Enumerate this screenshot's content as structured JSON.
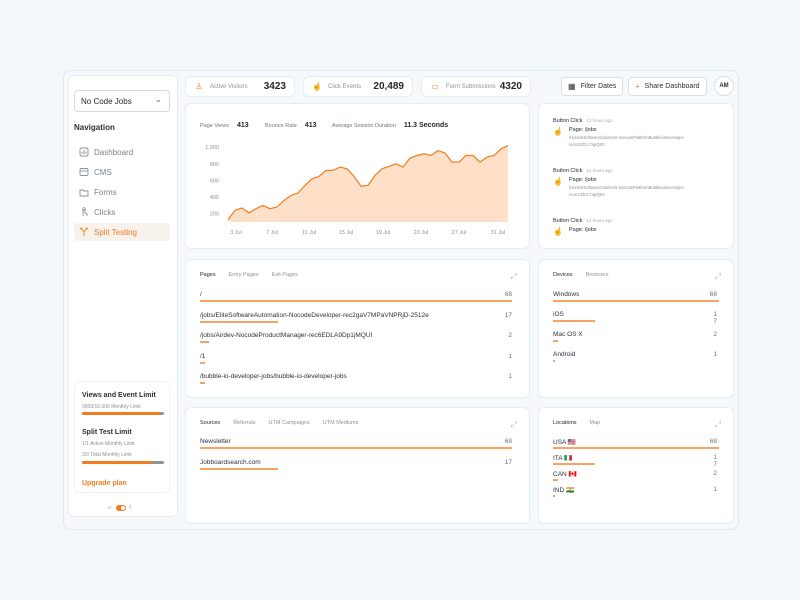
{
  "project_selector": {
    "value": "No Code Jobs"
  },
  "navigation": {
    "heading": "Navigation",
    "items": [
      {
        "label": "Dashboard",
        "icon": "dashboard-icon",
        "active": false
      },
      {
        "label": "CMS",
        "icon": "cms-icon",
        "active": false
      },
      {
        "label": "Forms",
        "icon": "forms-icon",
        "active": false
      },
      {
        "label": "Clicks",
        "icon": "clicks-icon",
        "active": false
      },
      {
        "label": "Split Testing",
        "icon": "split-testing-icon",
        "active": true
      }
    ]
  },
  "limits": {
    "views_title": "Views and Event Limit",
    "views_sub": "9500/10,000 Monthly Limit",
    "views_fraction": 0.95,
    "split_title": "Split Test Limit",
    "split_sub1": "1/1 Active Monthly Limit",
    "split_sub2": "3/3 Total Monthly Limit",
    "split_fraction": 0.85,
    "upgrade": "Upgrade plan"
  },
  "stats": [
    {
      "label": "Active Visitors",
      "value": "3423",
      "icon": "visitors-icon"
    },
    {
      "label": "Click Events",
      "value": "20,489",
      "icon": "click-icon"
    },
    {
      "label": "Form Submissions",
      "value": "4320",
      "icon": "form-icon"
    }
  ],
  "header": {
    "filter_dates": "Filter Dates",
    "share_dashboard": "Share Dashboard",
    "avatar": "AM"
  },
  "metrics": {
    "page_views_label": "Page Views",
    "page_views": "413",
    "bounce_rate_label": "Bounce Rate",
    "bounce_rate": "413",
    "session_label": "Average Session Duration",
    "session": "11.3 Seconds"
  },
  "chart_data": {
    "type": "area",
    "x_ticks": [
      "3 Jul",
      "7 Jul",
      "11 Jul",
      "15 Jul",
      "19 Jul",
      "23 Jul",
      "27 Jul",
      "31 Jul"
    ],
    "y_ticks": [
      "1,000",
      "800",
      "600",
      "400",
      "200"
    ],
    "ylim": [
      100,
      1050
    ],
    "values": [
      130,
      240,
      270,
      210,
      260,
      300,
      260,
      280,
      360,
      420,
      450,
      540,
      620,
      650,
      720,
      720,
      760,
      740,
      650,
      530,
      540,
      660,
      740,
      770,
      800,
      760,
      870,
      900,
      920,
      900,
      960,
      930,
      820,
      820,
      900,
      900,
      820,
      880,
      900,
      980,
      1020
    ],
    "color": "#f07d22",
    "fill": "#fde0c7"
  },
  "activity": [
    {
      "title": "Button Click",
      "time": "12 hours ago",
      "page": "Page: /jobs",
      "url": "/HonestSoftwareSolutions-NocodePlatformBubbleioDeveloper",
      "ref": "recn1t2fCc7apQE0"
    },
    {
      "title": "Button Click",
      "time": "12 hours ago",
      "page": "Page: /jobs",
      "url": "/HonestSoftwareSolutions-NocodePlatformBubbleioDeveloper",
      "ref": "recn1t2fCc7apQE0"
    },
    {
      "title": "Button Click",
      "time": "12 hours ago",
      "page": "Page: /jobs",
      "url": "",
      "ref": ""
    }
  ],
  "pages_panel": {
    "tabs": [
      "Pages",
      "Entry Pages",
      "Exit Pages"
    ],
    "rows": [
      {
        "label": "/",
        "value": "68",
        "fraction": 1.0
      },
      {
        "label": "/jobs/EliteSoftwareAutomation-NocodeDeveloper-rec2gaV7MPaVNPRjD-2512e",
        "value": "17",
        "fraction": 0.25
      },
      {
        "label": "/jobs/Airdev-NocodeProductManager-rec6EDLA9Dp1jMQUI",
        "value": "2",
        "fraction": 0.03
      },
      {
        "label": "/1",
        "value": "1",
        "fraction": 0.015
      },
      {
        "label": "/bubble-io-developer-jobs/bubble-io-developer-jobs",
        "value": "1",
        "fraction": 0.015
      }
    ]
  },
  "devices_panel": {
    "tabs": [
      "Devices",
      "Browsers"
    ],
    "rows": [
      {
        "label": "Windows",
        "value": "68",
        "value2": "",
        "fraction": 1.0
      },
      {
        "label": "iOS",
        "value": "1",
        "value2": "7",
        "fraction": 0.25
      },
      {
        "label": "Mac OS X",
        "value": "2",
        "value2": "",
        "fraction": 0.03
      },
      {
        "label": "Android",
        "value": "1",
        "value2": "",
        "fraction": 0.015
      }
    ]
  },
  "sources_panel": {
    "tabs": [
      "Sources",
      "Referrals",
      "UTM Campaigns",
      "UTM Mediums"
    ],
    "rows": [
      {
        "label": "Newsletter",
        "value": "68",
        "fraction": 1.0
      },
      {
        "label": "Jobboardsearch.com",
        "value": "17",
        "fraction": 0.25
      }
    ]
  },
  "locations_panel": {
    "tabs": [
      "Locations",
      "Map"
    ],
    "rows": [
      {
        "label": "USA 🇺🇸",
        "value": "68",
        "value2": "",
        "fraction": 1.0
      },
      {
        "label": "ITA 🇮🇹",
        "value": "1",
        "value2": "7",
        "fraction": 0.25
      },
      {
        "label": "CAN 🇨🇦",
        "value": "2",
        "value2": "",
        "fraction": 0.03
      },
      {
        "label": "IND 🇮🇳",
        "value": "1",
        "value2": "",
        "fraction": 0.015
      }
    ]
  }
}
